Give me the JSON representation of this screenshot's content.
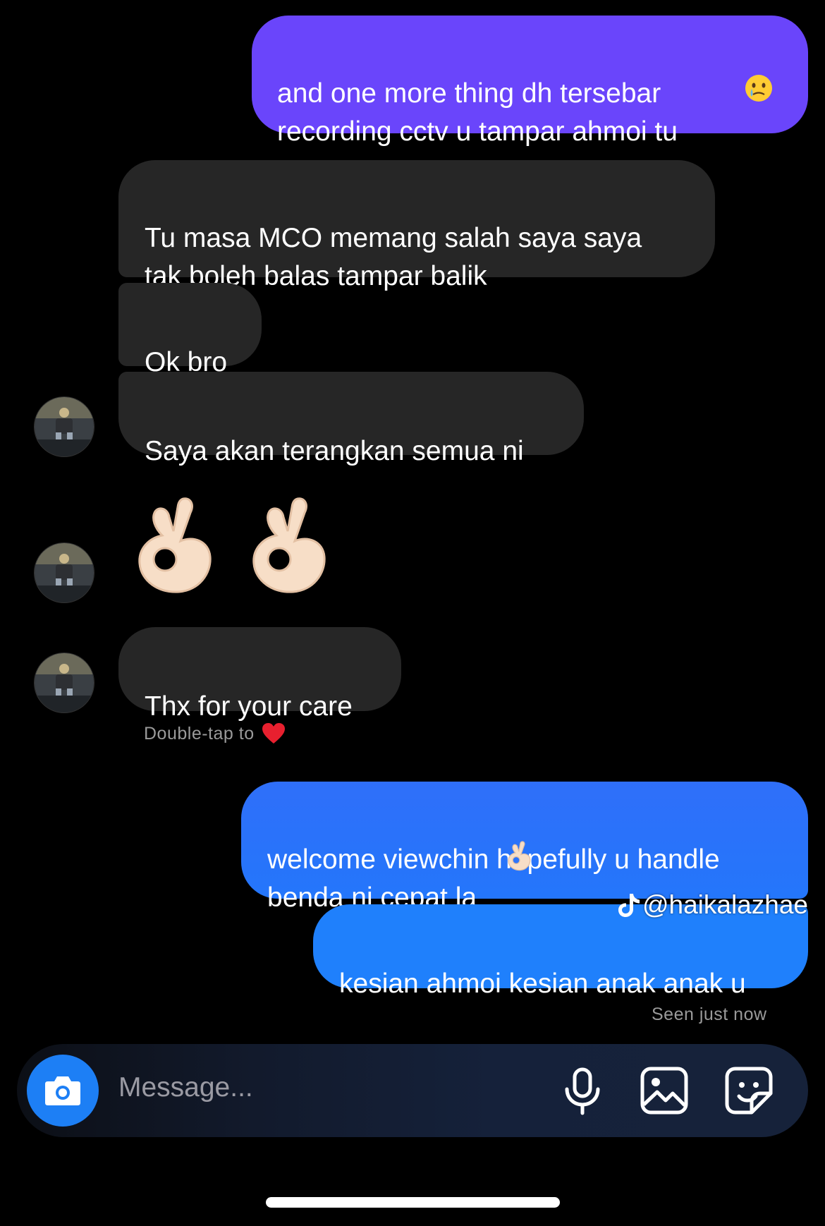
{
  "messages": [
    {
      "id": "out1",
      "text": "and one more thing dh tersebar\nrecording cctv u tampar ahmoi tu",
      "emoji": "holding-back-tears-emoji"
    },
    {
      "id": "in1",
      "text": "Tu masa MCO memang salah saya saya\ntak boleh balas tampar balik"
    },
    {
      "id": "in2",
      "text": "Ok bro"
    },
    {
      "id": "in3",
      "text": "Saya akan terangkan semua ni"
    },
    {
      "id": "in4",
      "text": "Thx for your care"
    },
    {
      "id": "out2",
      "text": "welcome viewchin hopefully u handle\nbenda ni cepat la",
      "emoji": "ok-hand-emoji"
    },
    {
      "id": "out3",
      "text": "kesian ahmoi kesian anak anak u"
    }
  ],
  "reaction_hint": {
    "text": "Double-tap to",
    "icon": "red-heart-icon"
  },
  "watermark": {
    "text": "@haikalazhae",
    "icon": "tiktok-logo-icon"
  },
  "seen_status": "Seen just now",
  "composer": {
    "placeholder": "Message...",
    "icons": [
      "camera-icon",
      "microphone-icon",
      "gallery-icon",
      "sticker-icon"
    ]
  },
  "colors": {
    "sent_purple": "#6a45fb",
    "sent_blue": "#1f80fc",
    "received_gray": "#262626",
    "camera_button": "#1d7ff5"
  }
}
